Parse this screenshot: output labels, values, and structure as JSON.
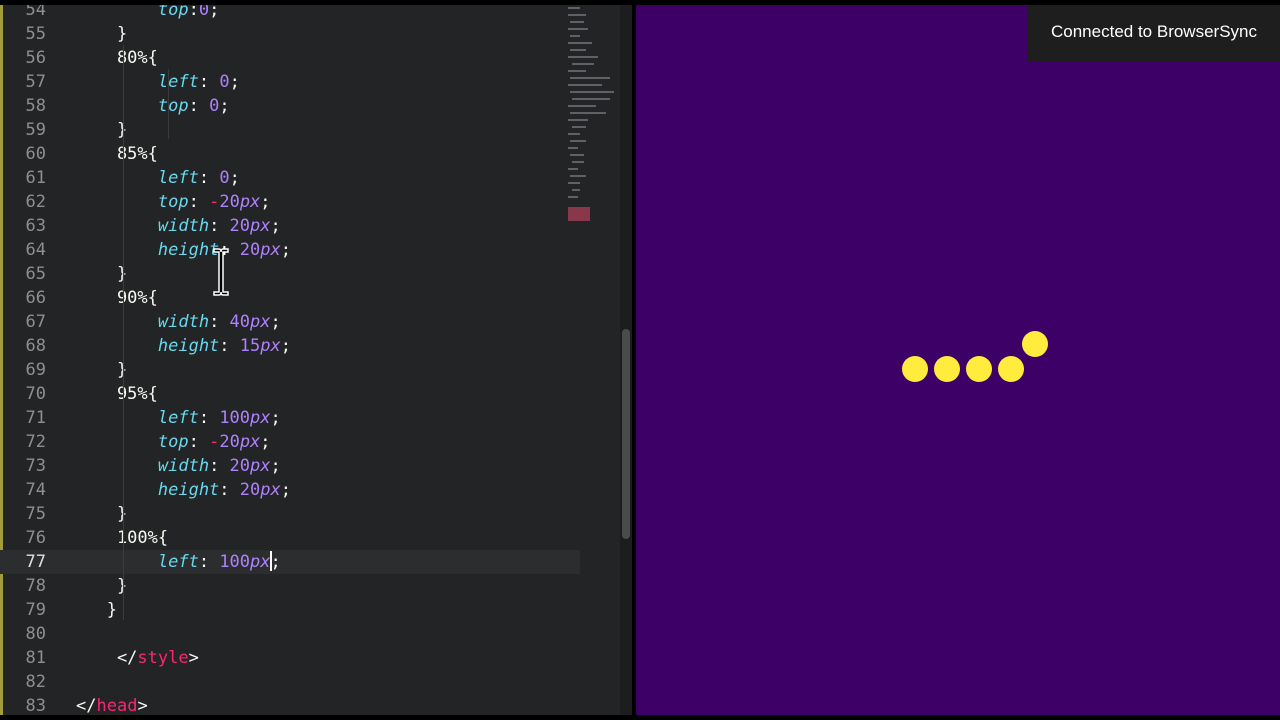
{
  "editor": {
    "lines": [
      {
        "n": "54",
        "tokens": [
          [
            "prop",
            "        top"
          ],
          [
            "punc",
            ":"
          ],
          [
            "num",
            "0"
          ],
          [
            "punc",
            ";"
          ]
        ]
      },
      {
        "n": "55",
        "tokens": [
          [
            "punc",
            "    }"
          ]
        ]
      },
      {
        "n": "56",
        "tokens": [
          [
            "sel",
            "    80%{"
          ]
        ]
      },
      {
        "n": "57",
        "tokens": [
          [
            "prop",
            "        left"
          ],
          [
            "punc",
            ": "
          ],
          [
            "num",
            "0"
          ],
          [
            "punc",
            ";"
          ]
        ]
      },
      {
        "n": "58",
        "tokens": [
          [
            "prop",
            "        top"
          ],
          [
            "punc",
            ": "
          ],
          [
            "num",
            "0"
          ],
          [
            "punc",
            ";"
          ]
        ]
      },
      {
        "n": "59",
        "tokens": [
          [
            "punc",
            "    }"
          ]
        ]
      },
      {
        "n": "60",
        "tokens": [
          [
            "sel",
            "    85%{"
          ]
        ]
      },
      {
        "n": "61",
        "tokens": [
          [
            "prop",
            "        left"
          ],
          [
            "punc",
            ": "
          ],
          [
            "num",
            "0"
          ],
          [
            "punc",
            ";"
          ]
        ]
      },
      {
        "n": "62",
        "tokens": [
          [
            "prop",
            "        top"
          ],
          [
            "punc",
            ": "
          ],
          [
            "tag",
            "-"
          ],
          [
            "num",
            "20"
          ],
          [
            "unit",
            "px"
          ],
          [
            "punc",
            ";"
          ]
        ]
      },
      {
        "n": "63",
        "tokens": [
          [
            "prop",
            "        width"
          ],
          [
            "punc",
            ": "
          ],
          [
            "num",
            "20"
          ],
          [
            "unit",
            "px"
          ],
          [
            "punc",
            ";"
          ]
        ]
      },
      {
        "n": "64",
        "tokens": [
          [
            "prop",
            "        height"
          ],
          [
            "punc",
            ": "
          ],
          [
            "num",
            "20"
          ],
          [
            "unit",
            "px"
          ],
          [
            "punc",
            ";"
          ]
        ]
      },
      {
        "n": "65",
        "tokens": [
          [
            "punc",
            "    }"
          ]
        ]
      },
      {
        "n": "66",
        "tokens": [
          [
            "sel",
            "    90%{"
          ]
        ]
      },
      {
        "n": "67",
        "tokens": [
          [
            "prop",
            "        width"
          ],
          [
            "punc",
            ": "
          ],
          [
            "num",
            "40"
          ],
          [
            "unit",
            "px"
          ],
          [
            "punc",
            ";"
          ]
        ]
      },
      {
        "n": "68",
        "tokens": [
          [
            "prop",
            "        height"
          ],
          [
            "punc",
            ": "
          ],
          [
            "num",
            "15"
          ],
          [
            "unit",
            "px"
          ],
          [
            "punc",
            ";"
          ]
        ]
      },
      {
        "n": "69",
        "tokens": [
          [
            "punc",
            "    }"
          ]
        ]
      },
      {
        "n": "70",
        "tokens": [
          [
            "sel",
            "    95%{"
          ]
        ]
      },
      {
        "n": "71",
        "tokens": [
          [
            "prop",
            "        left"
          ],
          [
            "punc",
            ": "
          ],
          [
            "num",
            "100"
          ],
          [
            "unit",
            "px"
          ],
          [
            "punc",
            ";"
          ]
        ]
      },
      {
        "n": "72",
        "tokens": [
          [
            "prop",
            "        top"
          ],
          [
            "punc",
            ": "
          ],
          [
            "tag",
            "-"
          ],
          [
            "num",
            "20"
          ],
          [
            "unit",
            "px"
          ],
          [
            "punc",
            ";"
          ]
        ]
      },
      {
        "n": "73",
        "tokens": [
          [
            "prop",
            "        width"
          ],
          [
            "punc",
            ": "
          ],
          [
            "num",
            "20"
          ],
          [
            "unit",
            "px"
          ],
          [
            "punc",
            ";"
          ]
        ]
      },
      {
        "n": "74",
        "tokens": [
          [
            "prop",
            "        height"
          ],
          [
            "punc",
            ": "
          ],
          [
            "num",
            "20"
          ],
          [
            "unit",
            "px"
          ],
          [
            "punc",
            ";"
          ]
        ]
      },
      {
        "n": "75",
        "tokens": [
          [
            "punc",
            "    }"
          ]
        ]
      },
      {
        "n": "76",
        "tokens": [
          [
            "sel",
            "    100%{"
          ]
        ]
      },
      {
        "n": "77",
        "tokens": [
          [
            "prop",
            "        left"
          ],
          [
            "punc",
            ": "
          ],
          [
            "num",
            "100"
          ],
          [
            "unit",
            "px"
          ],
          [
            "caret",
            ""
          ],
          [
            "punc",
            ";"
          ]
        ],
        "active": true
      },
      {
        "n": "78",
        "tokens": [
          [
            "punc",
            "    }"
          ]
        ]
      },
      {
        "n": "79",
        "tokens": [
          [
            "punc",
            "   }"
          ]
        ]
      },
      {
        "n": "80",
        "tokens": []
      },
      {
        "n": "81",
        "tokens": [
          [
            "punc",
            "    </"
          ],
          [
            "tag",
            "style"
          ],
          [
            "punc",
            ">"
          ]
        ]
      },
      {
        "n": "82",
        "tokens": []
      },
      {
        "n": "83",
        "tokens": [
          [
            "punc",
            "</"
          ],
          [
            "tag",
            "head"
          ],
          [
            "punc",
            ">"
          ]
        ]
      }
    ],
    "cursor_icon": "text-ibeam-cursor-icon"
  },
  "preview": {
    "toast_text": "Connected to BrowserSync",
    "dot_count": 5,
    "colors": {
      "background": "#3c0066",
      "dot": "#ffec3d"
    }
  }
}
